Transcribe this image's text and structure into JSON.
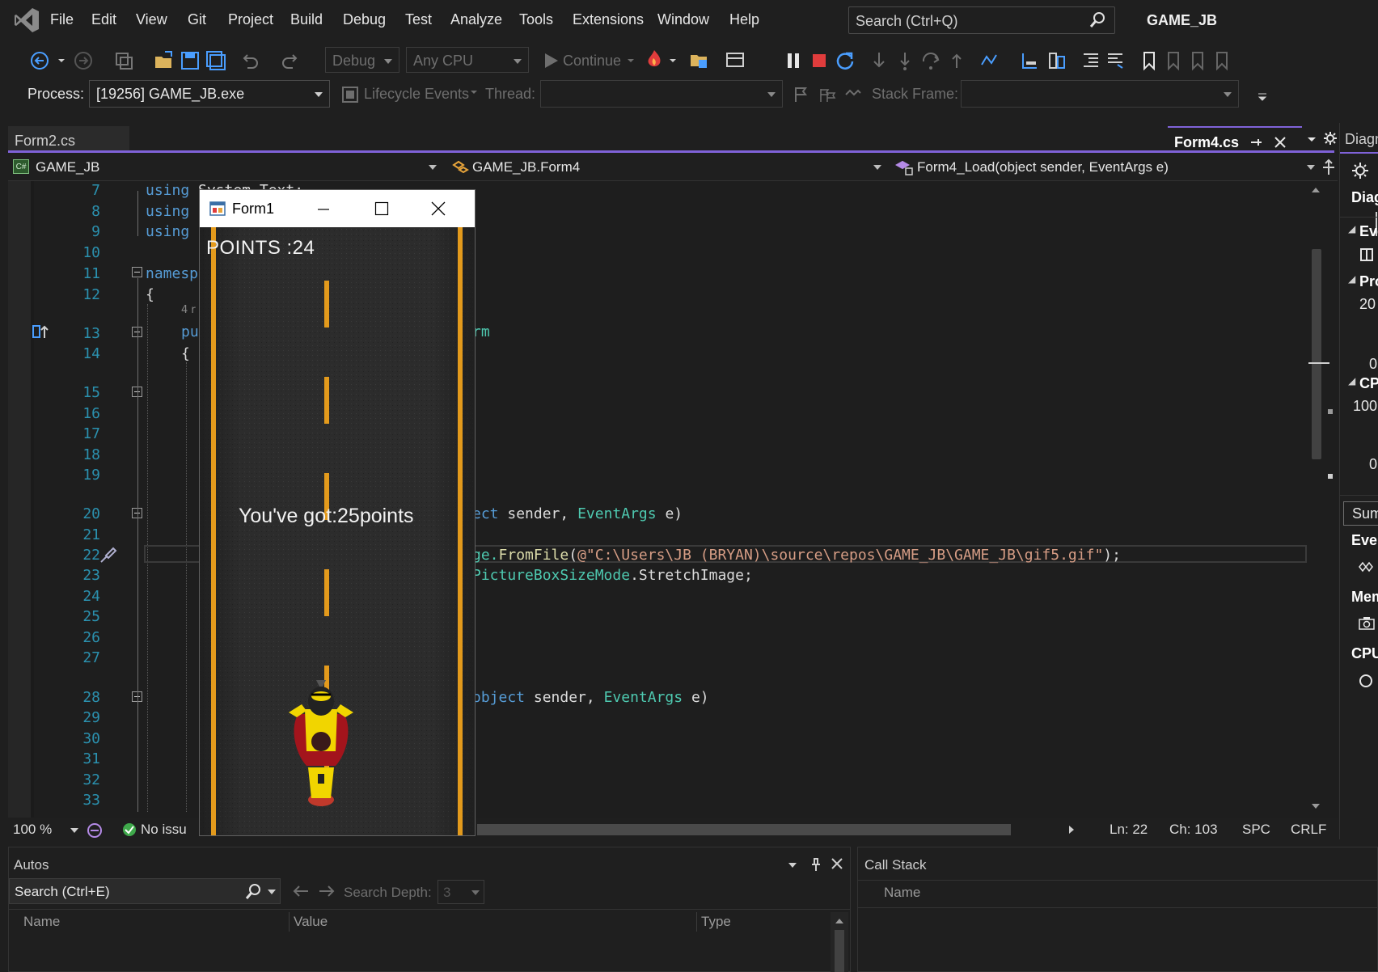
{
  "menubar": {
    "items": [
      "File",
      "Edit",
      "View",
      "Git",
      "Project",
      "Build",
      "Debug",
      "Test",
      "Analyze",
      "Tools",
      "Extensions",
      "Window",
      "Help"
    ],
    "search_placeholder": "Search (Ctrl+Q)",
    "solution_title": "GAME_JB"
  },
  "toolbar": {
    "config": "Debug",
    "platform": "Any CPU",
    "continue_label": "Continue"
  },
  "debug_location": {
    "process_label": "Process:",
    "process_value": "[19256] GAME_JB.exe",
    "lifecycle_label": "Lifecycle Events",
    "thread_label": "Thread:",
    "stackframe_label": "Stack Frame:"
  },
  "tabs": {
    "left": "Form2.cs",
    "active": "Form4.cs"
  },
  "navbar": {
    "project": "GAME_JB",
    "class": "GAME_JB.Form4",
    "member": "Form4_Load(object sender, EventArgs e)"
  },
  "editor": {
    "line_numbers": [
      "7",
      "8",
      "9",
      "10",
      "11",
      "12",
      "13",
      "14",
      "15",
      "16",
      "17",
      "18",
      "19",
      "20",
      "21",
      "22",
      "23",
      "24",
      "25",
      "26",
      "27",
      "28",
      "29",
      "30",
      "31",
      "32",
      "33"
    ],
    "codelens": "4 r",
    "lines": {
      "l7_kw": "using",
      "l7_rest": " System.Text;",
      "l8_kw": "using",
      "l9_kw": "using",
      "l11": "namesp",
      "l12": "{",
      "l13_kw": "pu",
      "l13_tail": "rm",
      "l14": "{",
      "l20_a": "ect",
      "l20_b": " sender",
      "l20_c": ", ",
      "l20_d": "EventArgs",
      "l20_e": " e)",
      "l22_a": "ge.",
      "l22_b": "FromFile",
      "l22_c": "(",
      "l22_d": "@\"C:\\Users\\JB (BRYAN)\\source\\repos\\GAME_JB\\GAME_JB\\gif5.gif\"",
      "l22_e": ");",
      "l23_a": "PictureBoxSizeMode",
      "l23_b": ".StretchImage;",
      "l28_a": "object",
      "l28_b": " sender",
      "l28_c": ", ",
      "l28_d": "EventArgs",
      "l28_e": " e)"
    }
  },
  "status": {
    "zoom": "100 %",
    "issues": "No issu",
    "ln": "Ln: 22",
    "ch": "Ch: 103",
    "spc": "SPC",
    "crlf": "CRLF"
  },
  "autos": {
    "title": "Autos",
    "search_placeholder": "Search (Ctrl+E)",
    "depth_label": "Search Depth:",
    "depth_value": "3",
    "columns": [
      "Name",
      "Value",
      "Type"
    ]
  },
  "callstack": {
    "title": "Call Stack",
    "columns": [
      "Name"
    ]
  },
  "diag": {
    "header": "Diagn",
    "diag_label": "Diag",
    "events": "Eve",
    "process": "Pro",
    "proc_top": "20",
    "proc_bottom": "0",
    "cpu": "CPU",
    "cpu_top": "100",
    "cpu_bottom": "0",
    "summary_tab": "Sum",
    "events2": "Even",
    "memory": "Mem",
    "cpu2": "CPU"
  },
  "form1": {
    "title": "Form1",
    "points": "POINTS :24",
    "message": "You've got:25points"
  },
  "colors": {
    "accent": "#7f62d8",
    "stop": "#e03c3c",
    "road_line": "#e39a1c"
  }
}
